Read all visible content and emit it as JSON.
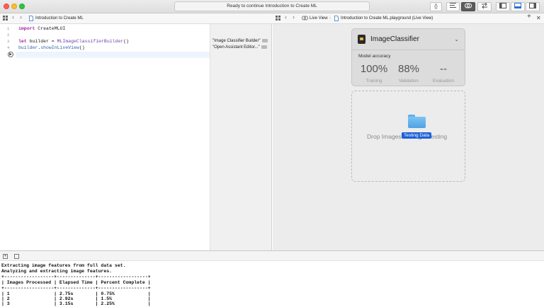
{
  "window": {
    "status_text": "Ready to continue Introduction to Create ML",
    "toolbar": {
      "braces_label": "{}",
      "add_label": "+"
    }
  },
  "editor": {
    "tab_title": "Introduction to Create ML",
    "line_numbers": [
      "1",
      "2",
      "3",
      "4",
      "5"
    ],
    "code": {
      "l1_kw": "import",
      "l1_rest": " CreateMLUI",
      "l3_kw": "let",
      "l3_mid": " builder = ",
      "l3_type": "MLImageClassifierBuilder",
      "l3_end": "()",
      "l4_obj": "builder",
      "l4_dot": ".",
      "l4_fn": "showInLiveView",
      "l4_end": "()"
    }
  },
  "results": {
    "items": [
      "\"Image Classifier Builder\"",
      "\"Open Assistant Editor...\""
    ]
  },
  "live_view": {
    "crumb_live": "Live View",
    "crumb_file": "Introduction to Create ML.playground (Live View)",
    "classifier": {
      "title": "ImageClassifier",
      "accuracy_label": "Model accuracy",
      "metrics": [
        {
          "value": "100%",
          "label": "Training"
        },
        {
          "value": "88%",
          "label": "Validation"
        },
        {
          "value": "--",
          "label": "Evaluation"
        }
      ]
    },
    "drop_zone": {
      "text": "Drop Images To Begin Testing",
      "drag_label": "Testing Data"
    }
  },
  "console": {
    "lines": [
      "Extracting image features from full data set.",
      "Analyzing and extracting image features.",
      "+------------------+--------------+------------------+",
      "| Images Processed | Elapsed Time | Percent Complete |",
      "+------------------+--------------+------------------+",
      "| 1                | 2.75s        | 0.75%            |",
      "| 2                | 2.92s        | 1.5%             |",
      "| 3                | 3.15s        | 2.25%            |"
    ]
  }
}
